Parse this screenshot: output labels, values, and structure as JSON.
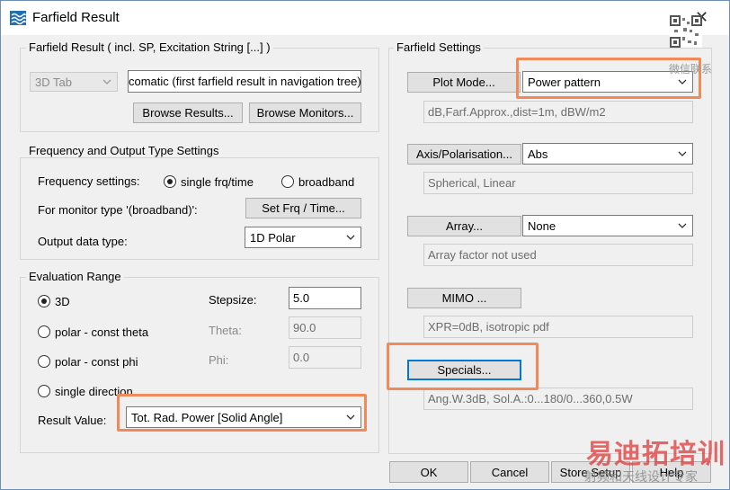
{
  "window": {
    "title": "Farfield Result"
  },
  "farfield_result": {
    "group_label": "Farfield Result ( incl. SP, Excitation String [...] )",
    "tab_select": "3D Tab",
    "result_field": "comatic (first farfield result in navigation tree)",
    "browse_results": "Browse Results...",
    "browse_monitors": "Browse Monitors..."
  },
  "frequency": {
    "group_label": "Frequency and Output Type Settings",
    "freq_label": "Frequency settings:",
    "single_label": "single frq/time",
    "broadband_label": "broadband",
    "monitor_label": "For monitor type '(broadband)':",
    "set_frq_button": "Set Frq / Time...",
    "output_label": "Output data type:",
    "output_value": "1D Polar"
  },
  "evaluation": {
    "group_label": "Evaluation Range",
    "r3d": "3D",
    "polar_theta": "polar - const theta",
    "polar_phi": "polar - const phi",
    "single_dir": "single direction",
    "stepsize_label": "Stepsize:",
    "stepsize_value": "5.0",
    "theta_label": "Theta:",
    "theta_value": "90.0",
    "phi_label": "Phi:",
    "phi_value": "0.0",
    "result_value_label": "Result Value:",
    "result_value": "Tot. Rad. Power [Solid Angle]"
  },
  "settings": {
    "group_label": "Farfield Settings",
    "plot_mode_button": "Plot Mode...",
    "plot_mode_value": "Power pattern",
    "plot_mode_info": "dB,Farf.Approx.,dist=1m, dBW/m2",
    "axis_button": "Axis/Polarisation...",
    "axis_value": "Abs",
    "axis_info": "Spherical, Linear",
    "array_button": "Array...",
    "array_value": "None",
    "array_info": "Array factor not used",
    "mimo_button": "MIMO ...",
    "mimo_info": "XPR=0dB, isotropic pdf",
    "specials_button": "Specials...",
    "specials_info": "Ang.W.3dB, Sol.A.:0...180/0...360,0.5W"
  },
  "footer": {
    "ok": "OK",
    "cancel": "Cancel",
    "store": "Store Setup",
    "help": "Help"
  },
  "watermark": {
    "qr_caption": "微信联系",
    "brand": "易迪拓培训",
    "tagline": "射频和天线设计专家"
  },
  "colors": {
    "highlight": "#f08a5a",
    "focus": "#0078d7",
    "brand_red": "#e03a3a"
  }
}
